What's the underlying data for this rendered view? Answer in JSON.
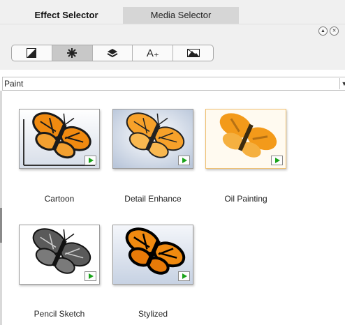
{
  "tabs": [
    {
      "label": "Effect Selector",
      "active": true
    },
    {
      "label": "Media Selector",
      "active": false
    }
  ],
  "window_controls": {
    "up_icon": "chevron-up-circle-icon",
    "close_icon": "close-circle-icon",
    "up_glyph": "▲",
    "close_glyph": "✕"
  },
  "toolbar": [
    {
      "icon": "square-diagonal-icon",
      "active": false
    },
    {
      "icon": "starburst-icon",
      "active": true
    },
    {
      "icon": "layers-icon",
      "active": false
    },
    {
      "icon": "text-plus-icon",
      "glyph": "A₊",
      "active": false
    },
    {
      "icon": "image-x-icon",
      "active": false
    }
  ],
  "category": {
    "selected": "Paint",
    "arrow": "▼"
  },
  "effects": [
    {
      "label": "Cartoon",
      "style": "cartoon",
      "selected": false
    },
    {
      "label": "Detail Enhance",
      "style": "detail",
      "selected": false
    },
    {
      "label": "Oil Painting",
      "style": "oil",
      "selected": true
    },
    {
      "label": "Pencil Sketch",
      "style": "pencil",
      "selected": false
    },
    {
      "label": "Stylized",
      "style": "stylized",
      "selected": false
    }
  ],
  "colors": {
    "wing_orange": "#f08a10",
    "wing_dark": "#1a1a1a",
    "play_green": "#1aa31a",
    "selected_border": "#f0c070"
  }
}
